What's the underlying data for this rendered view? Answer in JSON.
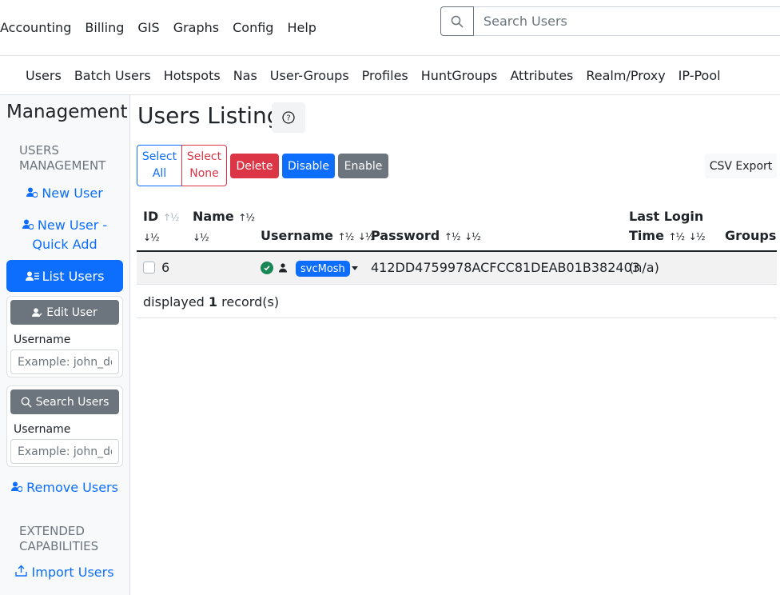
{
  "top_menu": [
    "Accounting",
    "Billing",
    "GIS",
    "Graphs",
    "Config",
    "Help"
  ],
  "search": {
    "placeholder": "Search Users"
  },
  "sub_menu": [
    "Users",
    "Batch Users",
    "Hotspots",
    "Nas",
    "User-Groups",
    "Profiles",
    "HuntGroups",
    "Attributes",
    "Realm/Proxy",
    "IP-Pool"
  ],
  "sidebar": {
    "title": "Management",
    "section_users": "USERS MANAGEMENT",
    "new_user": "New User",
    "new_user_quick": "New User - Quick Add",
    "list_users": "List Users",
    "edit_user_btn": "Edit User",
    "edit_label": "Username",
    "edit_placeholder": "Example: john_doe",
    "search_users_btn": "Search Users",
    "search_label": "Username",
    "search_placeholder": "Example: john_doe",
    "remove_users": "Remove Users",
    "section_extended": "EXTENDED CAPABILITIES",
    "import_users": "Import Users"
  },
  "main": {
    "title": "Users Listing",
    "buttons": {
      "select_all": "Select All",
      "select_none": "Select None",
      "delete": "Delete",
      "disable": "Disable",
      "enable": "Enable",
      "csv_export": "CSV Export"
    },
    "columns": {
      "id": "ID",
      "name": "Name",
      "username": "Username",
      "password": "Password",
      "last_login": "Last Login",
      "last_login_2": "Time",
      "groups": "Groups"
    },
    "rows": [
      {
        "id": "6",
        "name": "",
        "username": "svcMosh",
        "password": "412DD4759978ACFCC81DEAB01B382403",
        "last_login": "(n/a)",
        "groups": ""
      }
    ],
    "footer_prefix": "displayed",
    "footer_count": "1",
    "footer_suffix": "record(s)"
  },
  "colors": {
    "primary": "#0d6efd",
    "danger": "#dc3545",
    "secondary": "#6c757d",
    "success": "#198754"
  }
}
